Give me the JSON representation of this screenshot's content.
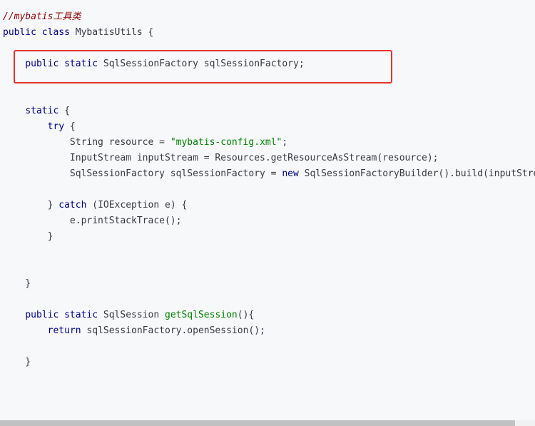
{
  "code": {
    "language": "java",
    "lines": [
      [
        {
          "t": "//mybatis工具类",
          "c": "comment"
        }
      ],
      [
        {
          "t": "public",
          "c": "kw"
        },
        {
          "t": " ",
          "c": "plain"
        },
        {
          "t": "class",
          "c": "kw"
        },
        {
          "t": " MybatisUtils {",
          "c": "plain"
        }
      ],
      [],
      [
        {
          "t": "    ",
          "c": "plain"
        },
        {
          "t": "public",
          "c": "kw"
        },
        {
          "t": " ",
          "c": "plain"
        },
        {
          "t": "static",
          "c": "kw"
        },
        {
          "t": " SqlSessionFactory sqlSessionFactory;",
          "c": "plain"
        }
      ],
      [],
      [],
      [
        {
          "t": "    ",
          "c": "plain"
        },
        {
          "t": "static",
          "c": "kw"
        },
        {
          "t": " {",
          "c": "plain"
        }
      ],
      [
        {
          "t": "        ",
          "c": "plain"
        },
        {
          "t": "try",
          "c": "kw"
        },
        {
          "t": " {",
          "c": "plain"
        }
      ],
      [
        {
          "t": "            String resource = ",
          "c": "plain"
        },
        {
          "t": "\"mybatis-config.xml\"",
          "c": "str"
        },
        {
          "t": ";",
          "c": "plain"
        }
      ],
      [
        {
          "t": "            InputStream inputStream = Resources.getResourceAsStream(resource);",
          "c": "plain"
        }
      ],
      [
        {
          "t": "            SqlSessionFactory sqlSessionFactory = ",
          "c": "plain"
        },
        {
          "t": "new",
          "c": "kw"
        },
        {
          "t": " SqlSessionFactoryBuilder().build(inputStream);",
          "c": "plain"
        }
      ],
      [],
      [
        {
          "t": "        } ",
          "c": "plain"
        },
        {
          "t": "catch",
          "c": "kw"
        },
        {
          "t": " (IOException e) {",
          "c": "plain"
        }
      ],
      [
        {
          "t": "            e.printStackTrace();",
          "c": "plain"
        }
      ],
      [
        {
          "t": "        }",
          "c": "plain"
        }
      ],
      [],
      [],
      [
        {
          "t": "    }",
          "c": "plain"
        }
      ],
      [],
      [
        {
          "t": "    ",
          "c": "plain"
        },
        {
          "t": "public",
          "c": "kw"
        },
        {
          "t": " ",
          "c": "plain"
        },
        {
          "t": "static",
          "c": "kw"
        },
        {
          "t": " SqlSession ",
          "c": "plain"
        },
        {
          "t": "getSqlSession",
          "c": "fn"
        },
        {
          "t": "(){",
          "c": "plain"
        }
      ],
      [
        {
          "t": "        ",
          "c": "plain"
        },
        {
          "t": "return",
          "c": "kw"
        },
        {
          "t": " sqlSessionFactory.openSession();",
          "c": "plain"
        }
      ],
      [],
      [
        {
          "t": "    }",
          "c": "plain"
        }
      ],
      [],
      [],
      [],
      [
        {
          "t": "}",
          "c": "plain"
        }
      ]
    ]
  },
  "highlight": {
    "color": "#e5322d",
    "covers_line": 4
  },
  "colors": {
    "background": "#f6f8fa",
    "keyword": "#000080",
    "string": "#008000",
    "comment": "#8b0000",
    "text": "#383a42"
  }
}
